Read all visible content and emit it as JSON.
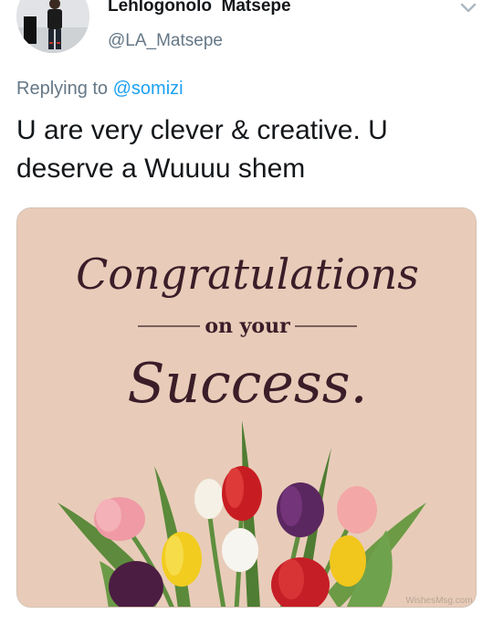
{
  "author": {
    "display_name": "Lehlogonolo  Matsepe",
    "handle": "@LA_Matsepe"
  },
  "reply": {
    "prefix": "Replying to ",
    "mention": "@somizi"
  },
  "tweet": {
    "text": "U are very clever & creative. U deserve a Wuuuu shem"
  },
  "media": {
    "headline": "Congratulations",
    "subline": "on your",
    "word": "Success.",
    "watermark": "WishesMsg.com"
  },
  "colors": {
    "card_background": "#e8ccb9",
    "script_text": "#3a1d28",
    "link": "#1da1f2",
    "muted": "#657786"
  },
  "icons": {
    "caret": "chevron-down-icon"
  }
}
